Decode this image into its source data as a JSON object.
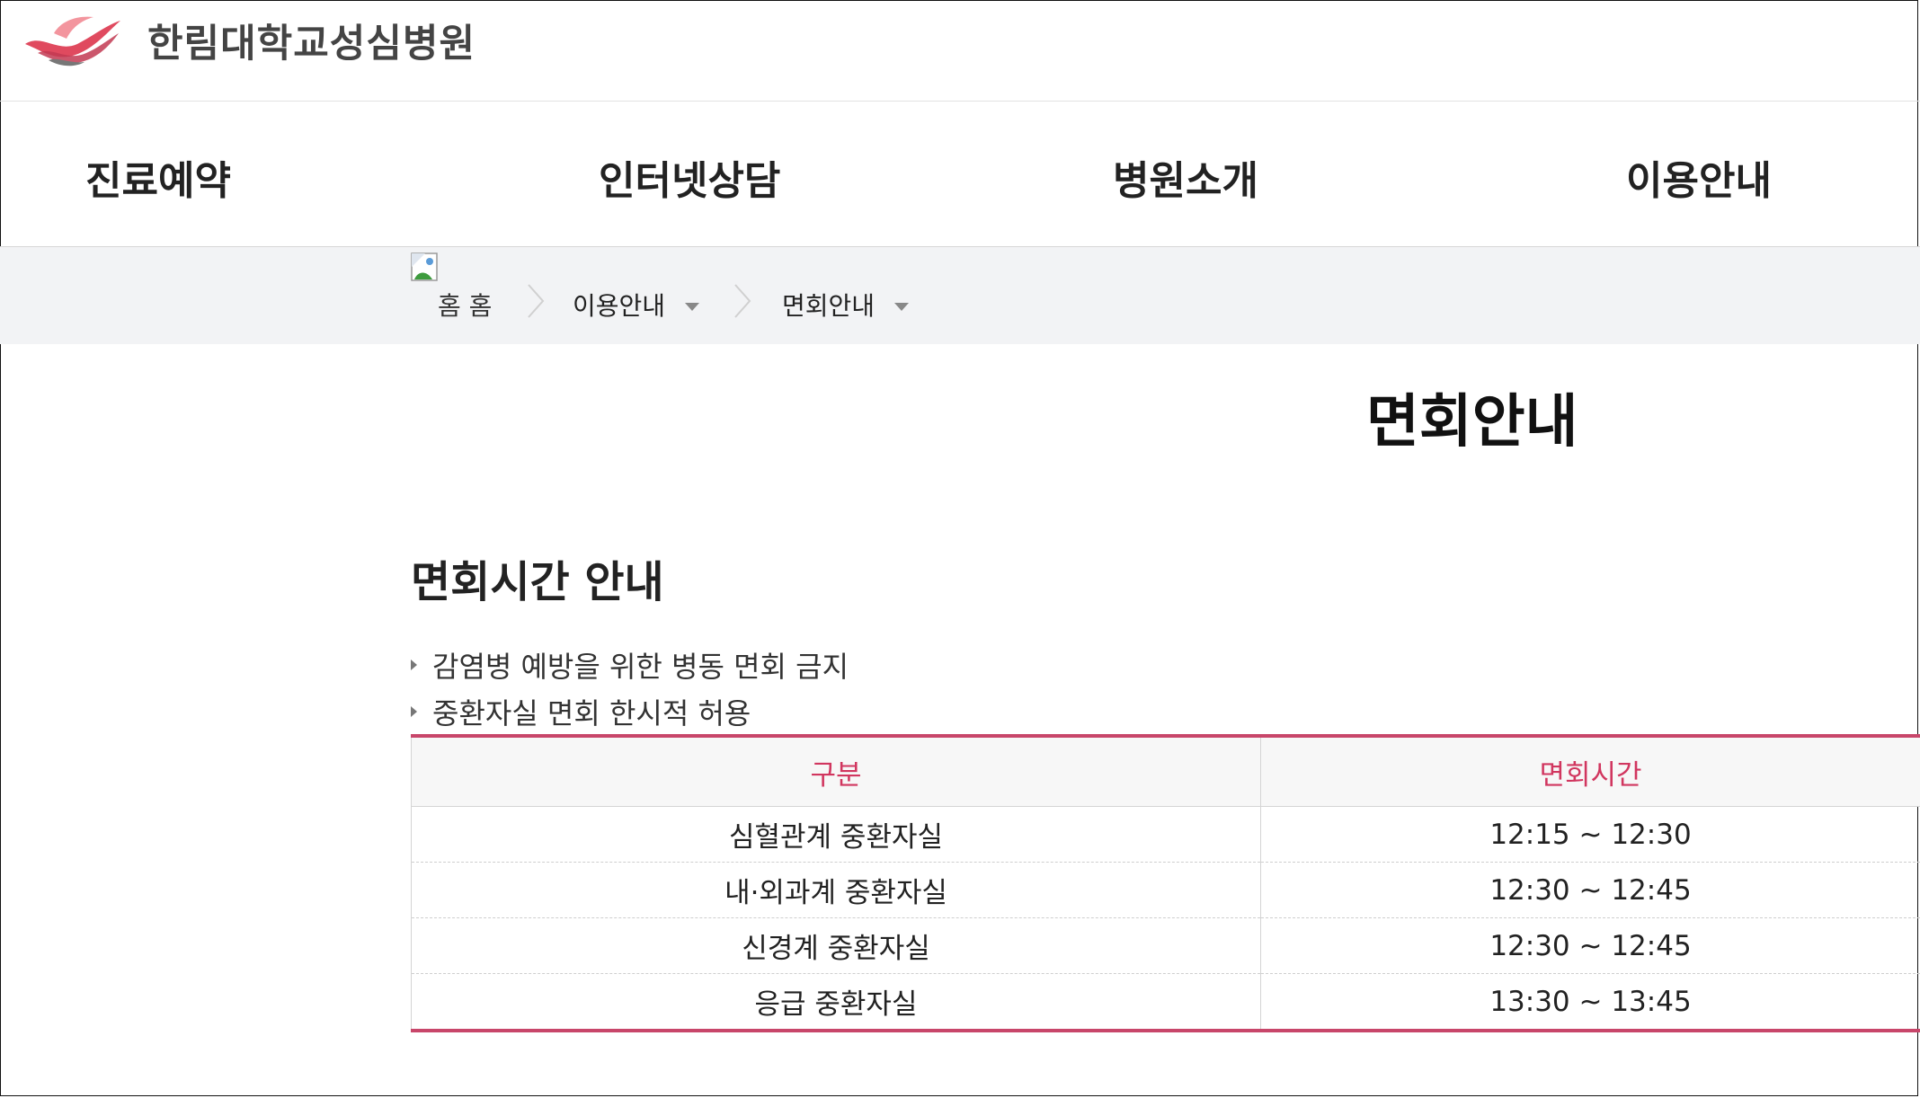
{
  "header": {
    "logo_text": "한림대학교성심병원",
    "logo_icon": "swoosh-logo-icon",
    "brand_color": "#e04a5f"
  },
  "nav": {
    "items": [
      {
        "label": "진료예약"
      },
      {
        "label": "인터넷상담"
      },
      {
        "label": "병원소개"
      },
      {
        "label": "이용안내"
      }
    ]
  },
  "breadcrumb": {
    "home_label": "홈 홈",
    "level1": "이용안내",
    "level2": "면회안내"
  },
  "page": {
    "title": "면회안내"
  },
  "section": {
    "title": "면회시간 안내",
    "bullets": [
      "감염병 예방을 위한 병동 면회 금지",
      "중환자실 면회 한시적 허용"
    ]
  },
  "table": {
    "headers": [
      "구분",
      "면회시간"
    ],
    "rows": [
      {
        "unit": "심혈관계 중환자실",
        "time": "12:15 ~ 12:30"
      },
      {
        "unit": "내·외과계 중환자실",
        "time": "12:30 ~ 12:45"
      },
      {
        "unit": "신경계 중환자실",
        "time": "12:30 ~ 12:45"
      },
      {
        "unit": "응급 중환자실",
        "time": "13:30 ~ 13:45"
      }
    ],
    "accent_color": "#c8466a",
    "header_text_color": "#d1365f"
  }
}
